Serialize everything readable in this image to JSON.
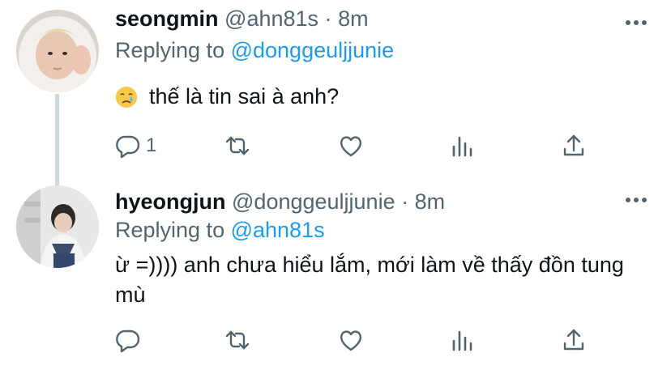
{
  "tweets": [
    {
      "display_name": "seongmin",
      "handle": "@ahn81s",
      "separator": "·",
      "time": "8m",
      "replying_prefix": "Replying to ",
      "replying_to": "@donggeuljjunie",
      "text": "thế là tin sai à anh?",
      "emoji": "crying-face-emoji",
      "reply_count": "1"
    },
    {
      "display_name": "hyeongjun",
      "handle": "@donggeuljjunie",
      "separator": "·",
      "time": "8m",
      "replying_prefix": "Replying to ",
      "replying_to": "@ahn81s",
      "text": "ừ =)))) anh chưa hiểu lắm, mới làm về thấy đồn tung mù",
      "reply_count": ""
    }
  ],
  "colors": {
    "accent": "#1d9bf0",
    "secondary_text": "#536471",
    "primary_text": "#0f1419",
    "thread_line": "#cfd9de"
  },
  "icons": [
    "reply-icon",
    "retweet-icon",
    "like-icon",
    "views-icon",
    "share-icon",
    "more-icon"
  ]
}
